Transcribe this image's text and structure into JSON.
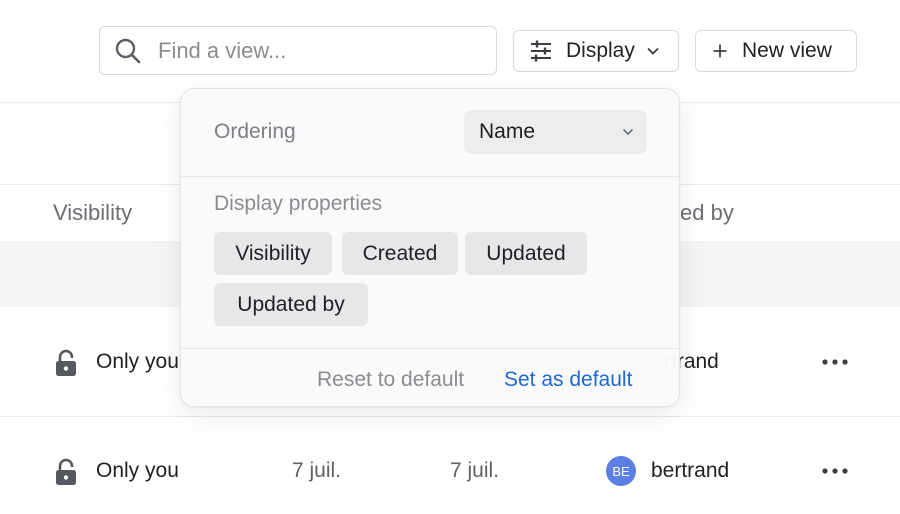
{
  "search": {
    "placeholder": "Find a view..."
  },
  "toolbar": {
    "display_label": "Display",
    "new_view_label": "New view",
    "icons": {
      "search": "search-icon",
      "display": "sliders-icon",
      "chevron": "chevron-down-icon",
      "new": "plus-icon"
    }
  },
  "table": {
    "columns": {
      "visibility": "Visibility",
      "updated_by_partial": "ed by"
    },
    "rows": [
      {
        "visibility": "Only you",
        "created": "",
        "updated": "",
        "avatar": "",
        "user": "bertrand"
      },
      {
        "visibility": "Only you",
        "created": "7 juil.",
        "updated": "7 juil.",
        "avatar": "BE",
        "user": "bertrand"
      }
    ],
    "row1_visible_user": "rtrand",
    "row1_visible_visibility": "Only you"
  },
  "popover": {
    "ordering_label": "Ordering",
    "ordering_value": "Name",
    "display_properties_label": "Display properties",
    "chips": [
      "Visibility",
      "Created",
      "Updated",
      "Updated by"
    ],
    "reset_label": "Reset to default",
    "set_default_label": "Set as default"
  },
  "colors": {
    "accent_link": "#1f67d1",
    "avatar": "#5b7fe3"
  }
}
